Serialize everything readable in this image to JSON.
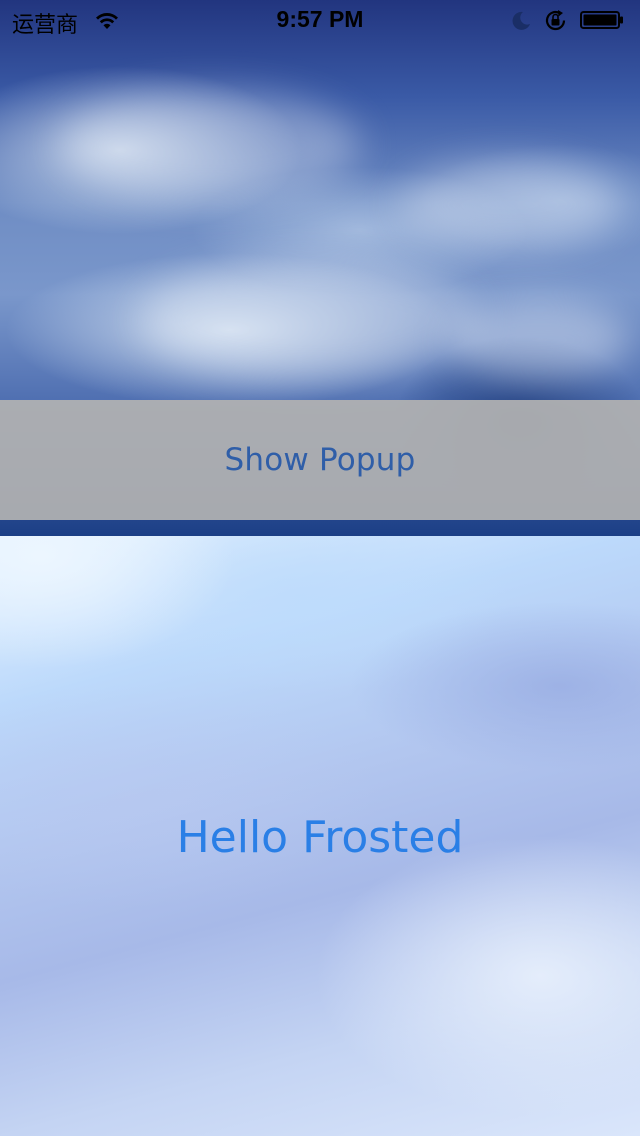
{
  "status_bar": {
    "carrier": "运营商",
    "time": "9:57 PM",
    "icons": [
      "wifi-icon",
      "moon-icon",
      "rotation-lock-icon",
      "battery-icon"
    ]
  },
  "popup_button": {
    "label": "Show Popup"
  },
  "frosted_view": {
    "label": "Hello Frosted"
  },
  "colors": {
    "button_text": "#2f5ea8",
    "hello_text": "#2a7fe6",
    "button_bar": "#b2b2b2"
  }
}
